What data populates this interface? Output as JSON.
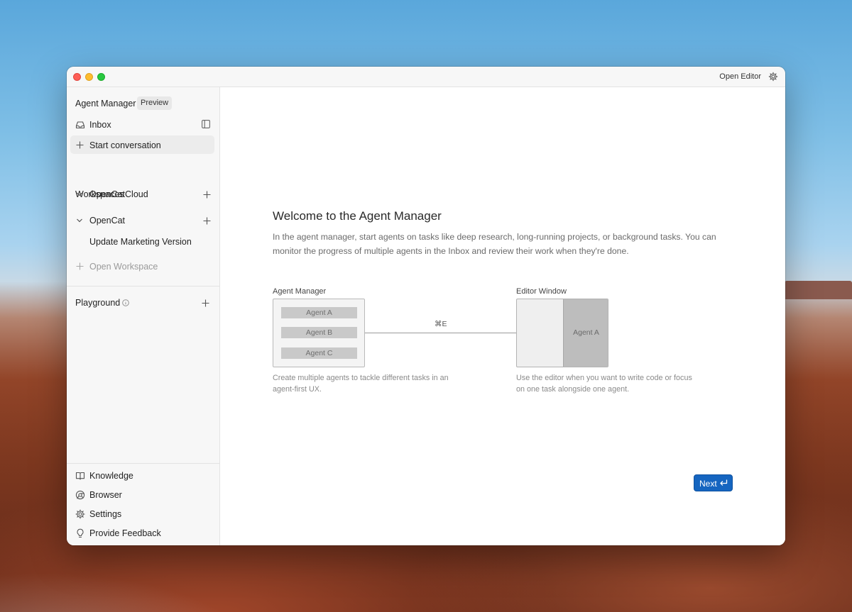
{
  "window": {
    "open_editor_label": "Open Editor"
  },
  "sidebar": {
    "app_title": "Agent Manager",
    "badge": "Preview",
    "inbox": "Inbox",
    "start_conversation": "Start conversation",
    "workspaces_label": "Workspaces",
    "workspaces": [
      {
        "name": "OpenCatCloud"
      },
      {
        "name": "OpenCat",
        "items": [
          "Update Marketing Version"
        ]
      }
    ],
    "open_workspace": "Open Workspace",
    "playground": "Playground",
    "bottom": {
      "knowledge": "Knowledge",
      "browser": "Browser",
      "settings": "Settings",
      "feedback": "Provide Feedback"
    }
  },
  "main": {
    "title": "Welcome to the Agent Manager",
    "description": "In the agent manager, start agents on tasks like deep research, long-running projects, or background tasks. You can monitor the progress of multiple agents in the Inbox and review their work when they're done.",
    "diagram": {
      "left_label": "Agent Manager",
      "agents": [
        "Agent A",
        "Agent B",
        "Agent C"
      ],
      "shortcut": "⌘E",
      "right_label": "Editor Window",
      "editor_agent": "Agent A",
      "left_caption": "Create multiple agents to tackle different tasks in an agent-first UX.",
      "right_caption": "Use the editor when you want to write code or focus on one task alongside one agent."
    },
    "next_label": "Next"
  }
}
